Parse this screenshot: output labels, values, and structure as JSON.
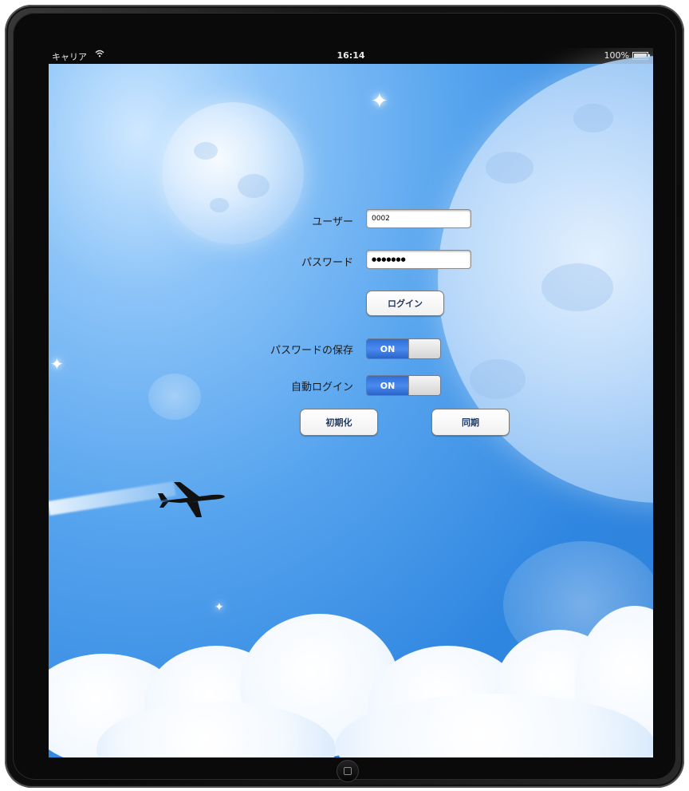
{
  "statusbar": {
    "carrier": "キャリア",
    "wifi_icon": "wifi-icon",
    "time": "16:14",
    "battery": "100%"
  },
  "login": {
    "user_label": "ユーザー",
    "user_value": "0002",
    "password_label": "パスワード",
    "password_value": "●●●●●●●",
    "login_button": "ログイン"
  },
  "settings": {
    "save_password_label": "パスワードの保存",
    "save_password_state": "ON",
    "auto_login_label": "自動ログイン",
    "auto_login_state": "ON"
  },
  "actions": {
    "reset_button": "初期化",
    "sync_button": "同期"
  },
  "colors": {
    "sky": "#3a8fe6",
    "toggle_on": "#3a7ae0"
  }
}
